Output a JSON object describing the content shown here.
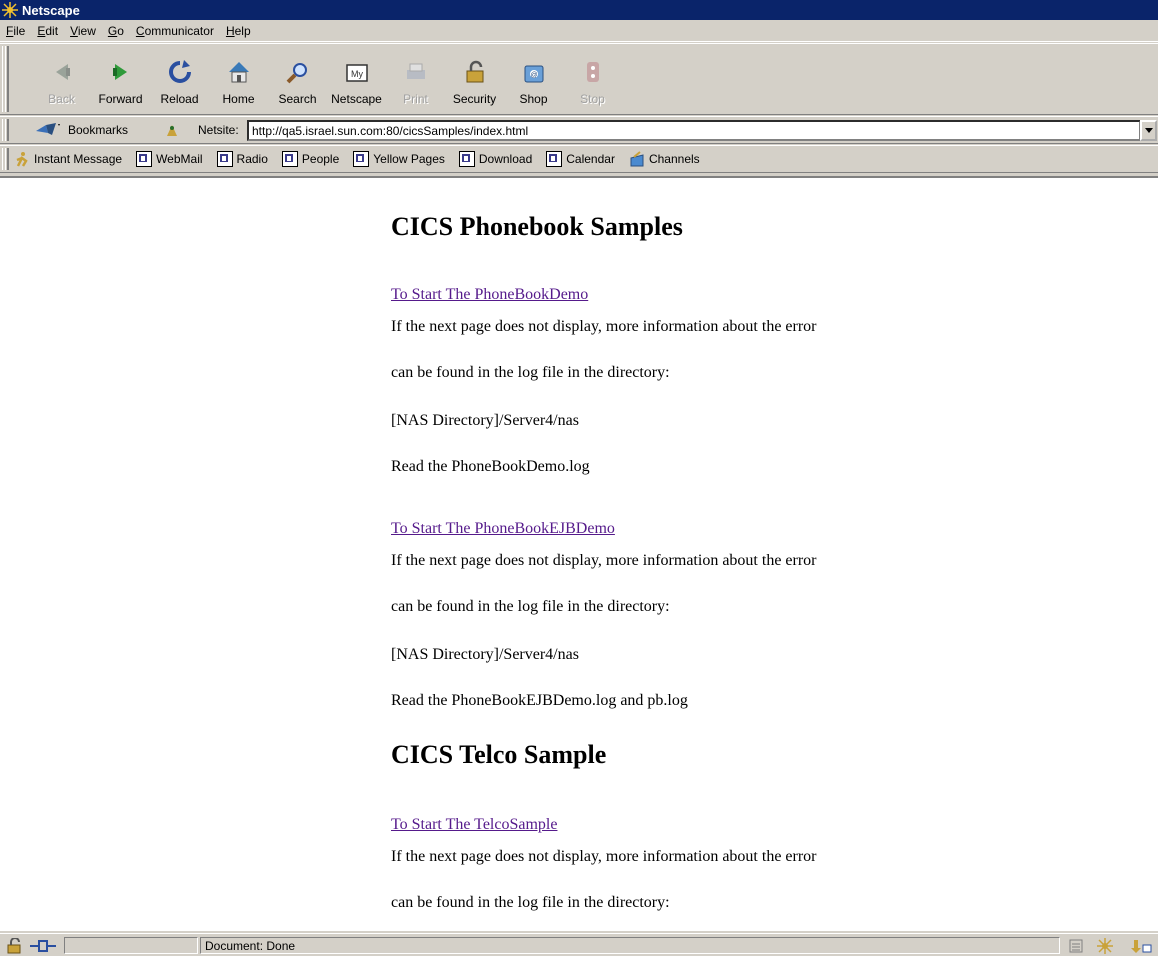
{
  "window": {
    "title": "Netscape"
  },
  "menubar": {
    "items": [
      {
        "label": "File"
      },
      {
        "label": "Edit"
      },
      {
        "label": "View"
      },
      {
        "label": "Go"
      },
      {
        "label": "Communicator"
      },
      {
        "label": "Help"
      }
    ]
  },
  "navigation": {
    "buttons": [
      {
        "label": "Back",
        "icon": "back-icon",
        "enabled": false
      },
      {
        "label": "Forward",
        "icon": "forward-icon",
        "enabled": true
      },
      {
        "label": "Reload",
        "icon": "reload-icon",
        "enabled": true
      },
      {
        "label": "Home",
        "icon": "home-icon",
        "enabled": true
      },
      {
        "label": "Search",
        "icon": "search-icon",
        "enabled": true
      },
      {
        "label": "Netscape",
        "icon": "my-netscape-icon",
        "enabled": true
      },
      {
        "label": "Print",
        "icon": "print-icon",
        "enabled": false
      },
      {
        "label": "Security",
        "icon": "security-icon",
        "enabled": true
      },
      {
        "label": "Shop",
        "icon": "shop-icon",
        "enabled": true
      },
      {
        "label": "Stop",
        "icon": "stop-icon",
        "enabled": false
      }
    ]
  },
  "location": {
    "bookmarks_label": "Bookmarks",
    "netsite_label": "Netsite:",
    "url": "http://qa5.israel.sun.com:80/cicsSamples/index.html"
  },
  "personal_toolbar": {
    "items": [
      {
        "label": "Instant Message",
        "icon": "instant-message-icon"
      },
      {
        "label": "WebMail",
        "icon": "bookmark-page-icon"
      },
      {
        "label": "Radio",
        "icon": "bookmark-page-icon"
      },
      {
        "label": "People",
        "icon": "bookmark-page-icon"
      },
      {
        "label": "Yellow Pages",
        "icon": "bookmark-page-icon"
      },
      {
        "label": "Download",
        "icon": "bookmark-page-icon"
      },
      {
        "label": "Calendar",
        "icon": "bookmark-page-icon"
      },
      {
        "label": "Channels",
        "icon": "channels-icon"
      }
    ]
  },
  "page": {
    "heading1": "CICS Phonebook Samples",
    "section1": {
      "link": "To Start The PhoneBookDemo",
      "lines": [
        "If the next page does not display, more information about the error",
        "can be found in the log file in the directory:",
        "[NAS Directory]/Server4/nas",
        "Read the PhoneBookDemo.log"
      ]
    },
    "section2": {
      "link": "To Start The PhoneBookEJBDemo",
      "lines": [
        "If the next page does not display, more information about the error",
        "can be found in the log file in the directory:",
        "[NAS Directory]/Server4/nas",
        "Read the PhoneBookEJBDemo.log and pb.log"
      ]
    },
    "heading2": "CICS Telco Sample",
    "section3": {
      "link": "To Start The TelcoSample",
      "lines": [
        "If the next page does not display, more information about the error",
        "can be found in the log file in the directory:"
      ]
    }
  },
  "status": {
    "text": "Document: Done"
  },
  "colors": {
    "titlebar": "#0a246a",
    "chrome": "#d4d0c8",
    "visited_link": "#551a8b"
  }
}
